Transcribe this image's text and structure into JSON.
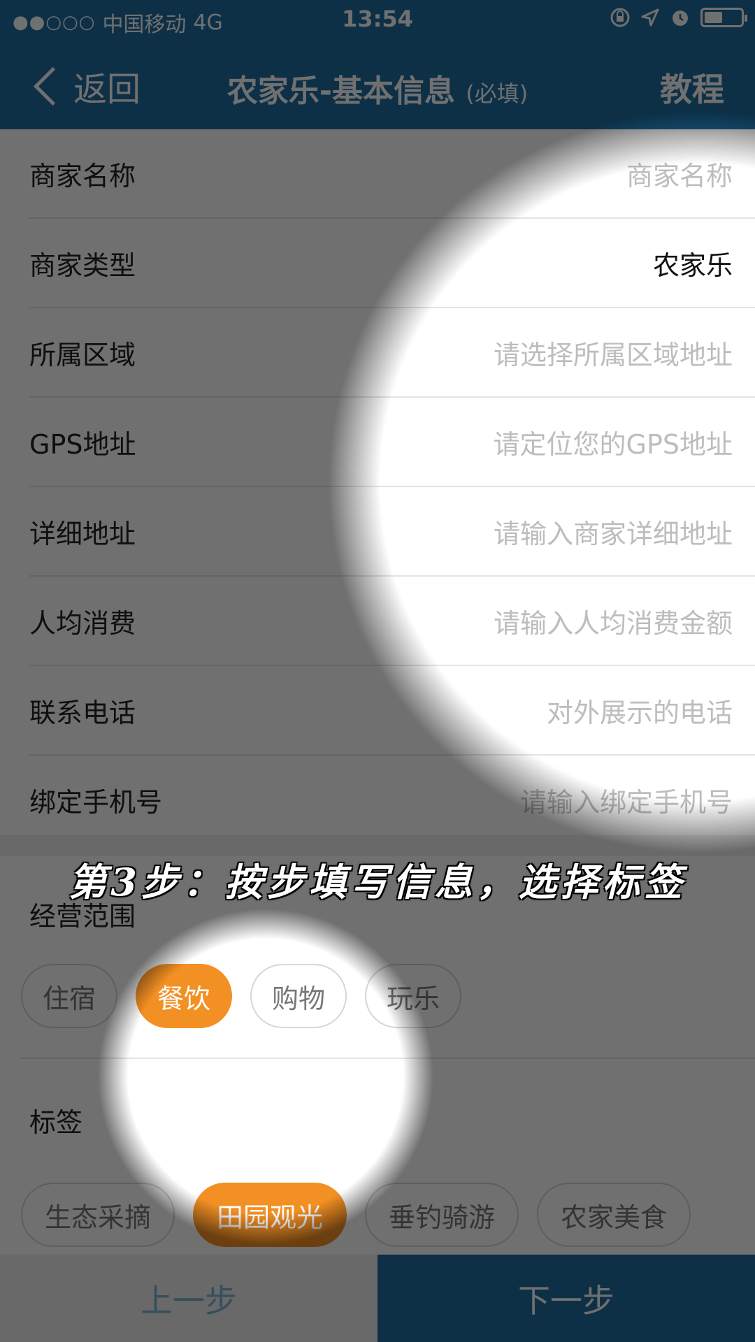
{
  "status_bar": {
    "signal": "●●○○○",
    "carrier": "中国移动",
    "network": "4G",
    "time": "13:54",
    "icons": [
      "rotation-lock-icon",
      "location-arrow-icon",
      "alarm-clock-icon",
      "battery-icon"
    ]
  },
  "nav": {
    "back_label": "返回",
    "title": "农家乐-基本信息",
    "title_note": "(必填)",
    "tutorial_label": "教程"
  },
  "form": {
    "rows": [
      {
        "label": "商家名称",
        "value": "商家名称"
      },
      {
        "label": "商家类型",
        "value": "农家乐"
      },
      {
        "label": "所属区域",
        "value": "请选择所属区域地址"
      },
      {
        "label": "GPS地址",
        "value": "请定位您的GPS地址"
      },
      {
        "label": "详细地址",
        "value": "请输入商家详细地址"
      },
      {
        "label": "人均消费",
        "value": "请输入人均消费金额"
      },
      {
        "label": "联系电话",
        "value": "对外展示的电话"
      },
      {
        "label": "绑定手机号",
        "value": "请输入绑定手机号"
      }
    ]
  },
  "caption": "第3步：按步填写信息，选择标签",
  "business_scope": {
    "title": "经营范围",
    "options": [
      "住宿",
      "餐饮",
      "购物",
      "玩乐"
    ],
    "selected": "餐饮"
  },
  "tags": {
    "title": "标签",
    "options": [
      "生态采摘",
      "田园观光",
      "垂钓骑游",
      "农家美食"
    ],
    "selected": "田园观光"
  },
  "footer": {
    "prev_label": "上一步",
    "next_label": "下一步"
  },
  "colors": {
    "primary": "#1f6fa3",
    "accent": "#f39024"
  }
}
